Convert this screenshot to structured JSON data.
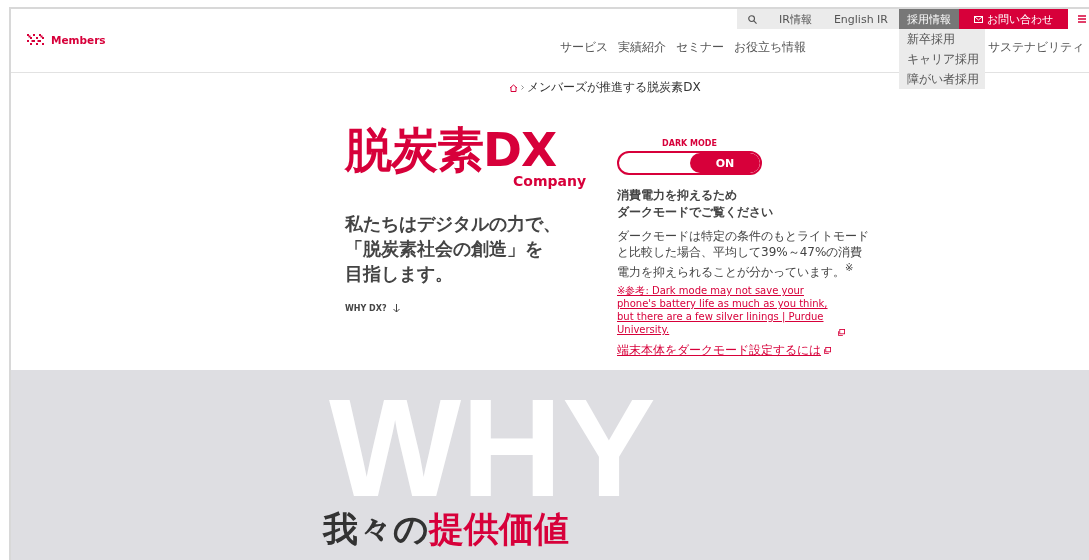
{
  "logo": {
    "text": "Members"
  },
  "utility_nav": [
    {
      "kind": "search"
    },
    {
      "kind": "link",
      "label": "IR情報"
    },
    {
      "kind": "link",
      "label": "English IR"
    },
    {
      "kind": "menu",
      "label": "採用情報",
      "expanded": true,
      "children": [
        "新卒採用",
        "キャリア採用",
        "障がい者採用"
      ]
    },
    {
      "kind": "contact",
      "label": "お問い合わせ"
    },
    {
      "kind": "hamburger"
    }
  ],
  "main_nav": [
    "サービス",
    "実績紹介",
    "セミナー",
    "お役立ち情報",
    "サステナビリティ"
  ],
  "breadcrumb": {
    "current": "メンバーズが推進する脱炭素DX"
  },
  "hero": {
    "title": "脱炭素DX",
    "title_sub": "Company",
    "lead": [
      "私たちはデジタルの力で、",
      "「脱炭素社会の創造」を",
      "目指します。"
    ],
    "why_link": "WHY DX?"
  },
  "dark_mode": {
    "label": "DARK MODE",
    "on": true,
    "state_text": "ON",
    "heading": [
      "消費電力を抑えるため",
      "ダークモードでご覧ください"
    ],
    "body": "ダークモードは特定の条件のもとライトモードと比較した場合、平均して39%～47%の消費電力を抑えられることが分かっています。$^{※}$",
    "reference_link": "※参考: Dark mode may not save your phone's battery life as much as you think, but there are a few silver linings | Purdue University.",
    "settings_link": "端末本体をダークモード設定するには"
  },
  "why": {
    "bg_word": "WHY",
    "title": "我々の",
    "title_highlight": "提供価値"
  }
}
